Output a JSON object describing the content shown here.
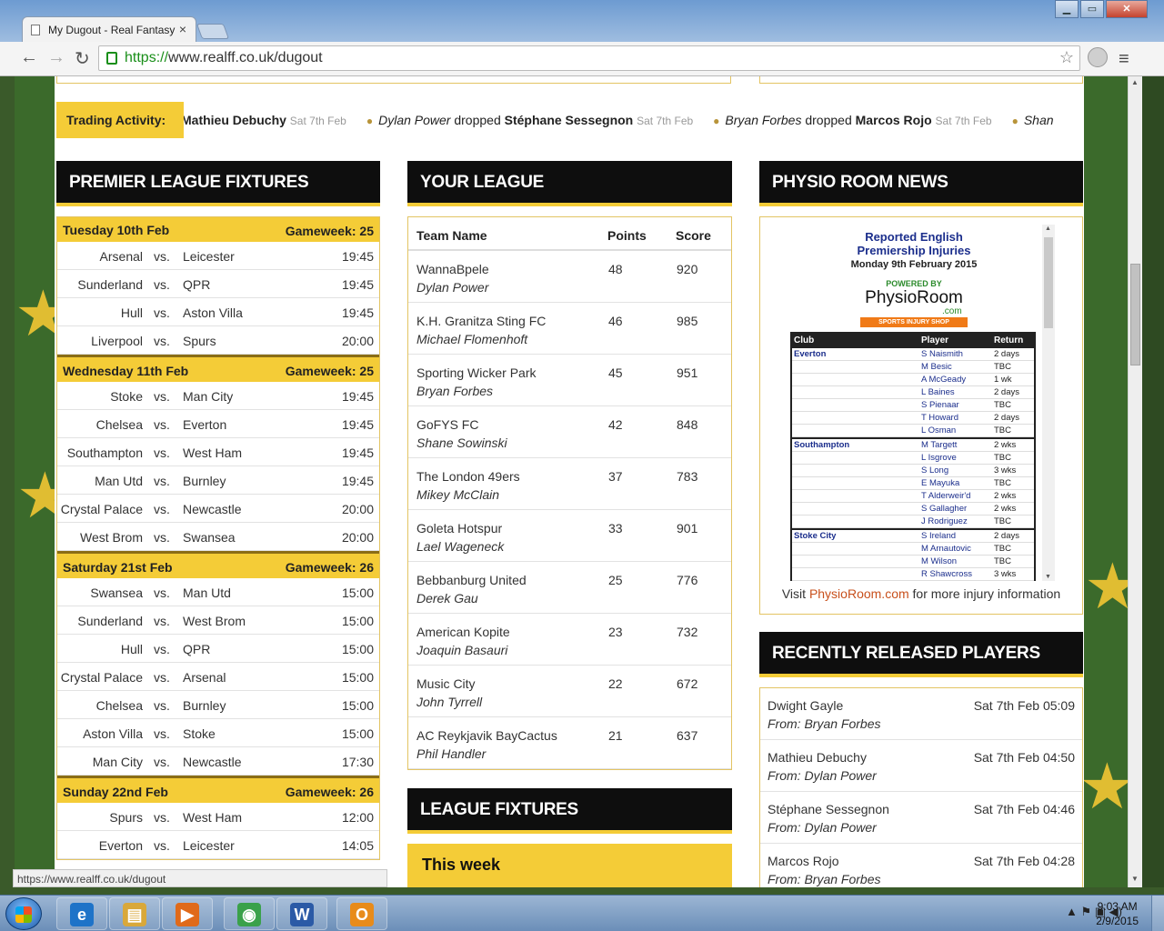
{
  "browser": {
    "tab_title": "My Dugout - Real Fantasy",
    "tab_close": "×",
    "url_scheme": "https://",
    "url_rest": "www.realff.co.uk/dugout",
    "back": "←",
    "forward": "→",
    "reload": "↻",
    "bookmark_star": "☆",
    "menu": "≡",
    "win_min": "▁",
    "win_max": "▭",
    "win_close": "✕",
    "status_url": "https://www.realff.co.uk/dugout"
  },
  "ticker": {
    "label": "Trading Activity:",
    "items": [
      {
        "who": "",
        "action": "",
        "player": "Mathieu Debuchy",
        "date": "Sat 7th Feb",
        "show_icon": false
      },
      {
        "who": "Dylan Power",
        "action": "dropped",
        "player": "Stéphane Sessegnon",
        "date": "Sat 7th Feb",
        "show_icon": true
      },
      {
        "who": "Bryan Forbes",
        "action": "dropped",
        "player": "Marcos Rojo",
        "date": "Sat 7th Feb",
        "show_icon": true
      },
      {
        "who": "Shan",
        "action": "",
        "player": "",
        "date": "",
        "show_icon": true
      }
    ]
  },
  "fixtures": {
    "heading": "PREMIER LEAGUE FIXTURES",
    "vs": "vs.",
    "days": [
      {
        "date": "Tuesday 10th Feb",
        "gameweek": "Gameweek: 25",
        "matches": [
          {
            "home": "Arsenal",
            "away": "Leicester",
            "time": "19:45"
          },
          {
            "home": "Sunderland",
            "away": "QPR",
            "time": "19:45"
          },
          {
            "home": "Hull",
            "away": "Aston Villa",
            "time": "19:45"
          },
          {
            "home": "Liverpool",
            "away": "Spurs",
            "time": "20:00"
          }
        ]
      },
      {
        "date": "Wednesday 11th Feb",
        "gameweek": "Gameweek: 25",
        "matches": [
          {
            "home": "Stoke",
            "away": "Man City",
            "time": "19:45"
          },
          {
            "home": "Chelsea",
            "away": "Everton",
            "time": "19:45"
          },
          {
            "home": "Southampton",
            "away": "West Ham",
            "time": "19:45"
          },
          {
            "home": "Man Utd",
            "away": "Burnley",
            "time": "19:45"
          },
          {
            "home": "Crystal Palace",
            "away": "Newcastle",
            "time": "20:00"
          },
          {
            "home": "West Brom",
            "away": "Swansea",
            "time": "20:00"
          }
        ]
      },
      {
        "date": "Saturday 21st Feb",
        "gameweek": "Gameweek: 26",
        "matches": [
          {
            "home": "Swansea",
            "away": "Man Utd",
            "time": "15:00"
          },
          {
            "home": "Sunderland",
            "away": "West Brom",
            "time": "15:00"
          },
          {
            "home": "Hull",
            "away": "QPR",
            "time": "15:00"
          },
          {
            "home": "Crystal Palace",
            "away": "Arsenal",
            "time": "15:00"
          },
          {
            "home": "Chelsea",
            "away": "Burnley",
            "time": "15:00"
          },
          {
            "home": "Aston Villa",
            "away": "Stoke",
            "time": "15:00"
          },
          {
            "home": "Man City",
            "away": "Newcastle",
            "time": "17:30"
          }
        ]
      },
      {
        "date": "Sunday 22nd Feb",
        "gameweek": "Gameweek: 26",
        "matches": [
          {
            "home": "Spurs",
            "away": "West Ham",
            "time": "12:00"
          },
          {
            "home": "Everton",
            "away": "Leicester",
            "time": "14:05"
          }
        ]
      }
    ]
  },
  "league": {
    "heading": "YOUR LEAGUE",
    "col_team": "Team Name",
    "col_points": "Points",
    "col_score": "Score",
    "rows": [
      {
        "team": "WannaBpele",
        "manager": "Dylan Power",
        "points": "48",
        "score": "920"
      },
      {
        "team": "K.H. Granitza Sting FC",
        "manager": "Michael Flomenhoft",
        "points": "46",
        "score": "985"
      },
      {
        "team": "Sporting Wicker Park",
        "manager": "Bryan Forbes",
        "points": "45",
        "score": "951"
      },
      {
        "team": "GoFYS FC",
        "manager": "Shane Sowinski",
        "points": "42",
        "score": "848"
      },
      {
        "team": "The London 49ers",
        "manager": "Mikey McClain",
        "points": "37",
        "score": "783"
      },
      {
        "team": "Goleta Hotspur",
        "manager": "Lael Wageneck",
        "points": "33",
        "score": "901"
      },
      {
        "team": "Bebbanburg United",
        "manager": "Derek Gau",
        "points": "25",
        "score": "776"
      },
      {
        "team": "American Kopite",
        "manager": "Joaquin Basauri",
        "points": "23",
        "score": "732"
      },
      {
        "team": "Music City",
        "manager": "John Tyrrell",
        "points": "22",
        "score": "672"
      },
      {
        "team": "AC Reykjavik BayCactus",
        "manager": "Phil Handler",
        "points": "21",
        "score": "637"
      }
    ]
  },
  "league_fixtures": {
    "heading": "LEAGUE FIXTURES",
    "this_week": "This week"
  },
  "physio": {
    "heading": "PHYSIO ROOM NEWS",
    "title_line1": "Reported English",
    "title_line2": "Premiership Injuries",
    "date": "Monday 9th February 2015",
    "powered": "POWERED BY",
    "logo": "PhysioRoom",
    "logo_com": ".com",
    "shop": "SPORTS INJURY SHOP",
    "col_club": "Club",
    "col_player": "Player",
    "col_return": "Return",
    "groups": [
      {
        "club": "Everton",
        "players": [
          {
            "player": "S Naismith",
            "ret": "2 days"
          },
          {
            "player": "M Besic",
            "ret": "TBC"
          },
          {
            "player": "A McGeady",
            "ret": "1 wk"
          },
          {
            "player": "L Baines",
            "ret": "2 days"
          },
          {
            "player": "S Pienaar",
            "ret": "TBC"
          },
          {
            "player": "T Howard",
            "ret": "2 days"
          },
          {
            "player": "L Osman",
            "ret": "TBC"
          }
        ]
      },
      {
        "club": "Southampton",
        "players": [
          {
            "player": "M Targett",
            "ret": "2 wks"
          },
          {
            "player": "L Isgrove",
            "ret": "TBC"
          },
          {
            "player": "S Long",
            "ret": "3 wks"
          },
          {
            "player": "E Mayuka",
            "ret": "TBC"
          },
          {
            "player": "T Alderweir'd",
            "ret": "2 wks"
          },
          {
            "player": "S Gallagher",
            "ret": "2 wks"
          },
          {
            "player": "J Rodriguez",
            "ret": "TBC"
          }
        ]
      },
      {
        "club": "Stoke City",
        "players": [
          {
            "player": "S Ireland",
            "ret": "2 days"
          },
          {
            "player": "M Arnautovic",
            "ret": "TBC"
          },
          {
            "player": "M Wilson",
            "ret": "TBC"
          },
          {
            "player": "R Shawcross",
            "ret": "3 wks"
          }
        ]
      }
    ],
    "visit_prefix": "Visit ",
    "visit_link": "PhysioRoom.com",
    "visit_suffix": " for more injury information"
  },
  "released": {
    "heading": "RECENTLY RELEASED PLAYERS",
    "rows": [
      {
        "name": "Dwight Gayle",
        "when": "Sat 7th Feb 05:09",
        "from": "From: Bryan Forbes"
      },
      {
        "name": "Mathieu Debuchy",
        "when": "Sat 7th Feb 04:50",
        "from": "From: Dylan Power"
      },
      {
        "name": "Stéphane Sessegnon",
        "when": "Sat 7th Feb 04:46",
        "from": "From: Dylan Power"
      },
      {
        "name": "Marcos Rojo",
        "when": "Sat 7th Feb 04:28",
        "from": "From: Bryan Forbes"
      }
    ]
  },
  "taskbar": {
    "time": "9:03 AM",
    "date": "2/9/2015",
    "apps": [
      {
        "name": "ie",
        "glyph": "e",
        "color": "#1e73c8"
      },
      {
        "name": "explorer",
        "glyph": "▤",
        "color": "#d9a83a"
      },
      {
        "name": "media",
        "glyph": "▶",
        "color": "#e06a1a"
      },
      {
        "name": "chrome",
        "glyph": "◉",
        "color": "#3aa14a"
      },
      {
        "name": "word",
        "glyph": "W",
        "color": "#2b5aa6"
      },
      {
        "name": "outlook",
        "glyph": "O",
        "color": "#e88b1a"
      }
    ],
    "tray_icons": "▲ ⚑ ▣ ◀)"
  },
  "colors": {
    "accent": "#f4cc37",
    "panel_header": "#0e0e0e"
  }
}
